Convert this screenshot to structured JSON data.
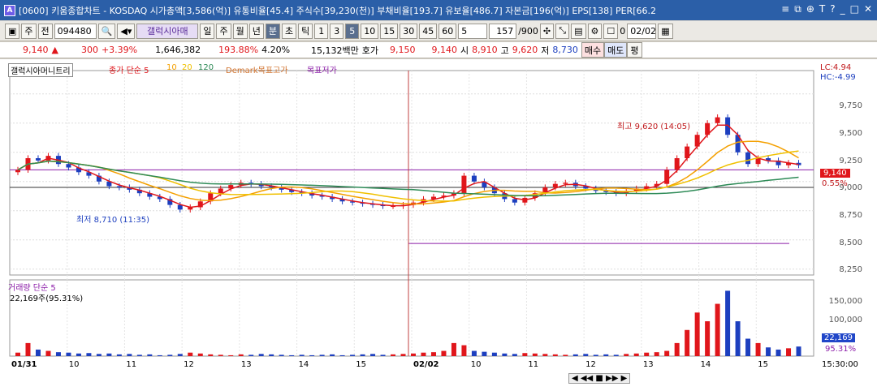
{
  "window": {
    "app_icon": "A",
    "title": "[0600] 키움종합차트 - KOSDAQ 시가총액[3,586(억)] 유통비율[45.4] 주식수[39,230(천)] 부채비율[193.7] 유보율[486.7] 자본금[196(억)] EPS[138] PER[66.2",
    "buttons": [
      "≡",
      "⧉",
      "⊕",
      "T",
      "?",
      "_",
      "□",
      "✕"
    ]
  },
  "toolbar": {
    "stock_type": "주",
    "prefix": "전",
    "code": "094480",
    "stock_name": "갤럭시아매",
    "periods": [
      "일",
      "주",
      "월",
      "년",
      "분",
      "초",
      "틱"
    ],
    "active_period": "분",
    "intervals": [
      "1",
      "3",
      "5",
      "10",
      "15",
      "30",
      "45",
      "60"
    ],
    "active_interval": "5",
    "interval_select": "5",
    "count": "157",
    "count_max": "/900",
    "checkbox_value": "0",
    "date": "02/02"
  },
  "info": {
    "price": "9,140",
    "arrow": "▲",
    "change": "300",
    "change_pct": "+3.39%",
    "volume": "1,646,382",
    "volume_pct": "193.88%",
    "turnover_pct": "4.20%",
    "amount": "15,132백만",
    "bid_label": "호가",
    "ask_price": "9,150",
    "bid_price": "9,140",
    "open_label": "시",
    "open": "8,910",
    "high_label": "고",
    "high": "9,620",
    "low_label": "저",
    "low": "8,730",
    "buy_btn": "매수",
    "sell_btn": "매도",
    "avg_btn": "평"
  },
  "legend": {
    "stock": "갤럭시아머니트리",
    "ma_label": "종가 단순 5",
    "ma10": "10",
    "ma20": "20",
    "ma120": "120",
    "demark": "Demark목표고가",
    "demark_low": "목표저가"
  },
  "annotations": {
    "high": "최고 9,620 (14:05)",
    "low": "최저 8,710 (11:35)",
    "lc": "LC:4.94",
    "hc": "HC:-4.99",
    "cur_price": "9,140",
    "cur_pct": "0.55%"
  },
  "price_axis": [
    "9,750",
    "9,500",
    "9,250",
    "9,000",
    "8,750",
    "8,500",
    "8,250"
  ],
  "volume_panel": {
    "title": "거래량 단순 5",
    "value": "22,169주(95.31%)",
    "axis": [
      "150,000",
      "100,000"
    ],
    "cur_value": "22,169",
    "cur_pct": "95.31%"
  },
  "time_axis": [
    "01/31",
    "10",
    "11",
    "12",
    "13",
    "14",
    "15",
    "02/02",
    "10",
    "11",
    "12",
    "13",
    "14",
    "15"
  ],
  "time_right": "15:30:00",
  "colors": {
    "up": "#e0161b",
    "down": "#1d3fbf",
    "ma5": "#e0161b",
    "ma10": "#f4a000",
    "ma20": "#f0c000",
    "ma120": "#2e8b57",
    "titlebar": "#2b5fa8"
  },
  "chart_data": {
    "type": "candlestick",
    "price_range": [
      8200,
      9950
    ],
    "closes": [
      9100,
      9200,
      9180,
      9220,
      9150,
      9120,
      9080,
      9050,
      9000,
      8960,
      8950,
      8930,
      8900,
      8870,
      8850,
      8800,
      8760,
      8780,
      8830,
      8900,
      8940,
      8970,
      8990,
      8980,
      8960,
      8950,
      8930,
      8910,
      8900,
      8880,
      8870,
      8850,
      8830,
      8820,
      8810,
      8800,
      8790,
      8790,
      8800,
      8820,
      8850,
      8870,
      8880,
      8900,
      9050,
      9000,
      8950,
      8900,
      8850,
      8820,
      8860,
      8900,
      8950,
      8980,
      8990,
      8960,
      8940,
      8920,
      8910,
      8900,
      8920,
      8940,
      8960,
      8980,
      9100,
      9200,
      9300,
      9400,
      9500,
      9550,
      9400,
      9250,
      9150,
      9200,
      9180,
      9140,
      9160,
      9140
    ],
    "volumes": [
      8000,
      30000,
      15000,
      12000,
      9000,
      8000,
      6000,
      7000,
      5000,
      6000,
      4000,
      5000,
      3000,
      4000,
      2000,
      3000,
      5000,
      8000,
      6000,
      4000,
      3000,
      2000,
      4000,
      3000,
      5000,
      4000,
      3000,
      2000,
      3000,
      2000,
      3000,
      4000,
      2000,
      3000,
      4000,
      5000,
      3000,
      4000,
      5000,
      6000,
      8000,
      9000,
      12000,
      30000,
      25000,
      12000,
      10000,
      8000,
      6000,
      5000,
      7000,
      6000,
      5000,
      4000,
      3000,
      4000,
      5000,
      3000,
      4000,
      3000,
      5000,
      6000,
      8000,
      9000,
      12000,
      30000,
      60000,
      100000,
      80000,
      120000,
      150000,
      80000,
      40000,
      30000,
      20000,
      15000,
      18000,
      22000,
      22169
    ],
    "volume_range": [
      0,
      175000
    ]
  }
}
